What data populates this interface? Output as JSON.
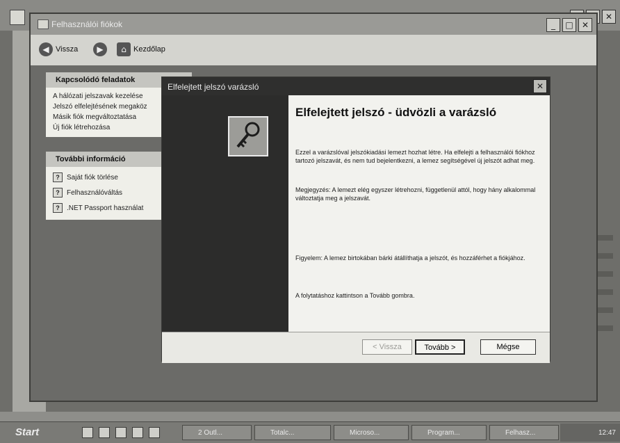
{
  "ua_window": {
    "title": "Felhasználói fiókok",
    "toolbar": {
      "back": "Vissza",
      "home": "Kezdőlap"
    }
  },
  "related_tasks": {
    "header": "Kapcsolódó feladatok",
    "items": [
      "A hálózati jelszavak kezelése",
      "Jelszó elfelejtésének megaköz",
      "Másik fiók megváltoztatása",
      "Új fiók létrehozása"
    ]
  },
  "more_info": {
    "header": "További információ",
    "items": [
      "Saját fiók törlése",
      "Felhasználóváltás",
      ".NET Passport használat"
    ]
  },
  "wizard": {
    "title": "Elfelejtett jelszó varázsló",
    "heading": "Elfelejtett jelszó - üdvözli a varázsló",
    "para1": "Ezzel a varázslóval jelszókiadási lemezt hozhat létre. Ha elfelejti a felhasználói fiókhoz tartozó jelszavát, és nem tud bejelentkezni, a lemez segítségével új jelszót adhat meg.",
    "para2": "Megjegyzés: A lemezt elég egyszer létrehozni, függetlenül attól, hogy hány alkalommal változtatja meg a jelszavát.",
    "para3": "Figyelem: A lemez birtokában bárki átállíthatja a jelszót, és hozzáférhet a fiókjához.",
    "para4": "A folytatáshoz kattintson a Tovább gombra.",
    "buttons": {
      "back": "< Vissza",
      "next": "Tovább >",
      "cancel": "Mégse"
    }
  },
  "taskbar": {
    "start": "Start",
    "tasks": [
      "2 Outl...",
      "Totalc...",
      "Microso...",
      "Program...",
      "Felhasz..."
    ],
    "clock": "12:47"
  }
}
